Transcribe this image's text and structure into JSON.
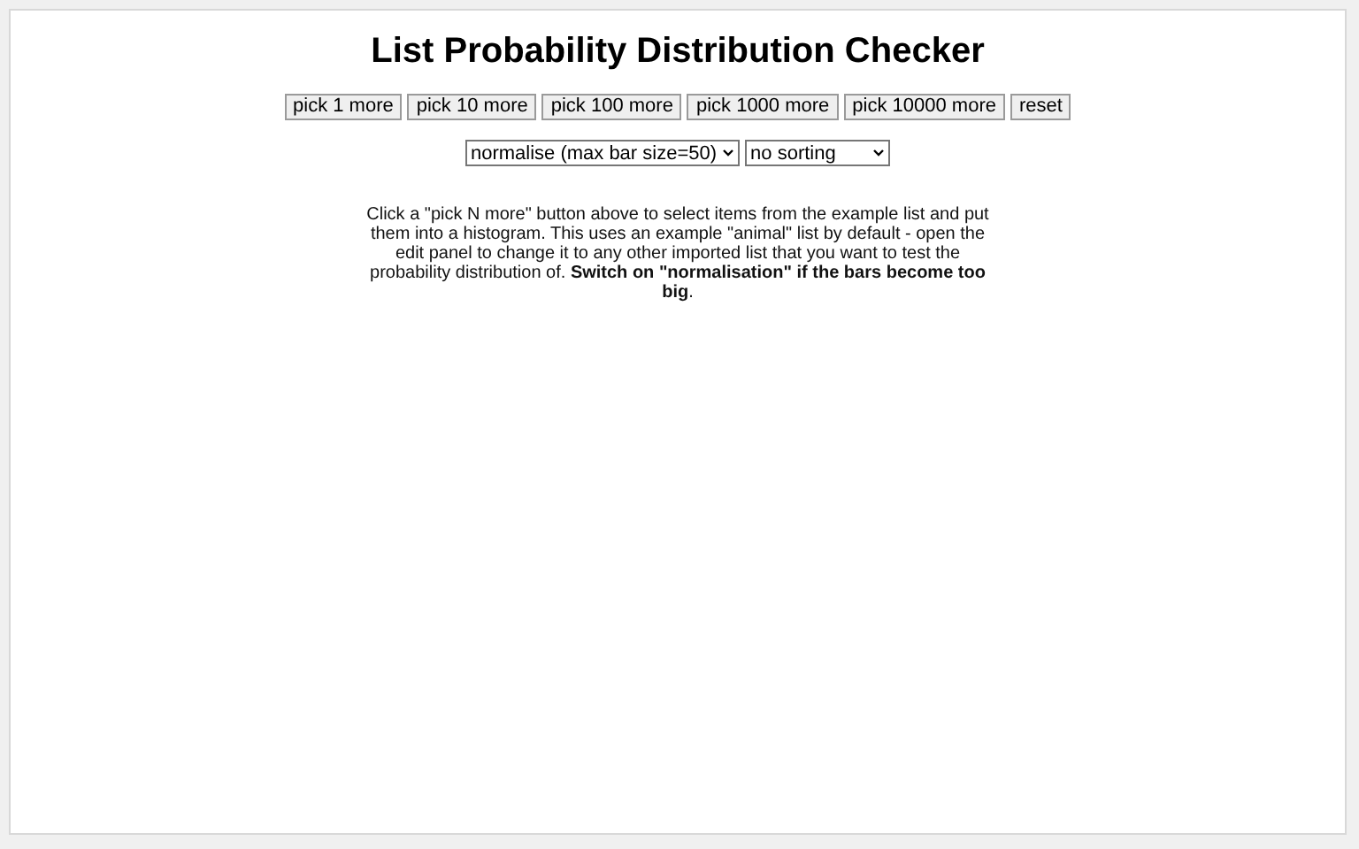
{
  "title": "List Probability Distribution Checker",
  "buttons": [
    "pick 1 more",
    "pick 10 more",
    "pick 100 more",
    "pick 1000 more",
    "pick 10000 more",
    "reset"
  ],
  "dropdowns": [
    {
      "value": "normalise (max bar size=50)"
    },
    {
      "value": "no sorting"
    }
  ],
  "description": "Click a \"pick N more\" button above to select items from the example list and put them into a histogram. This uses an example \"animal\" list by default - open the edit panel to change it to any other imported list that you want to test the probability distribution of. **Switch on \"normalisation\" if the bars become too big**."
}
